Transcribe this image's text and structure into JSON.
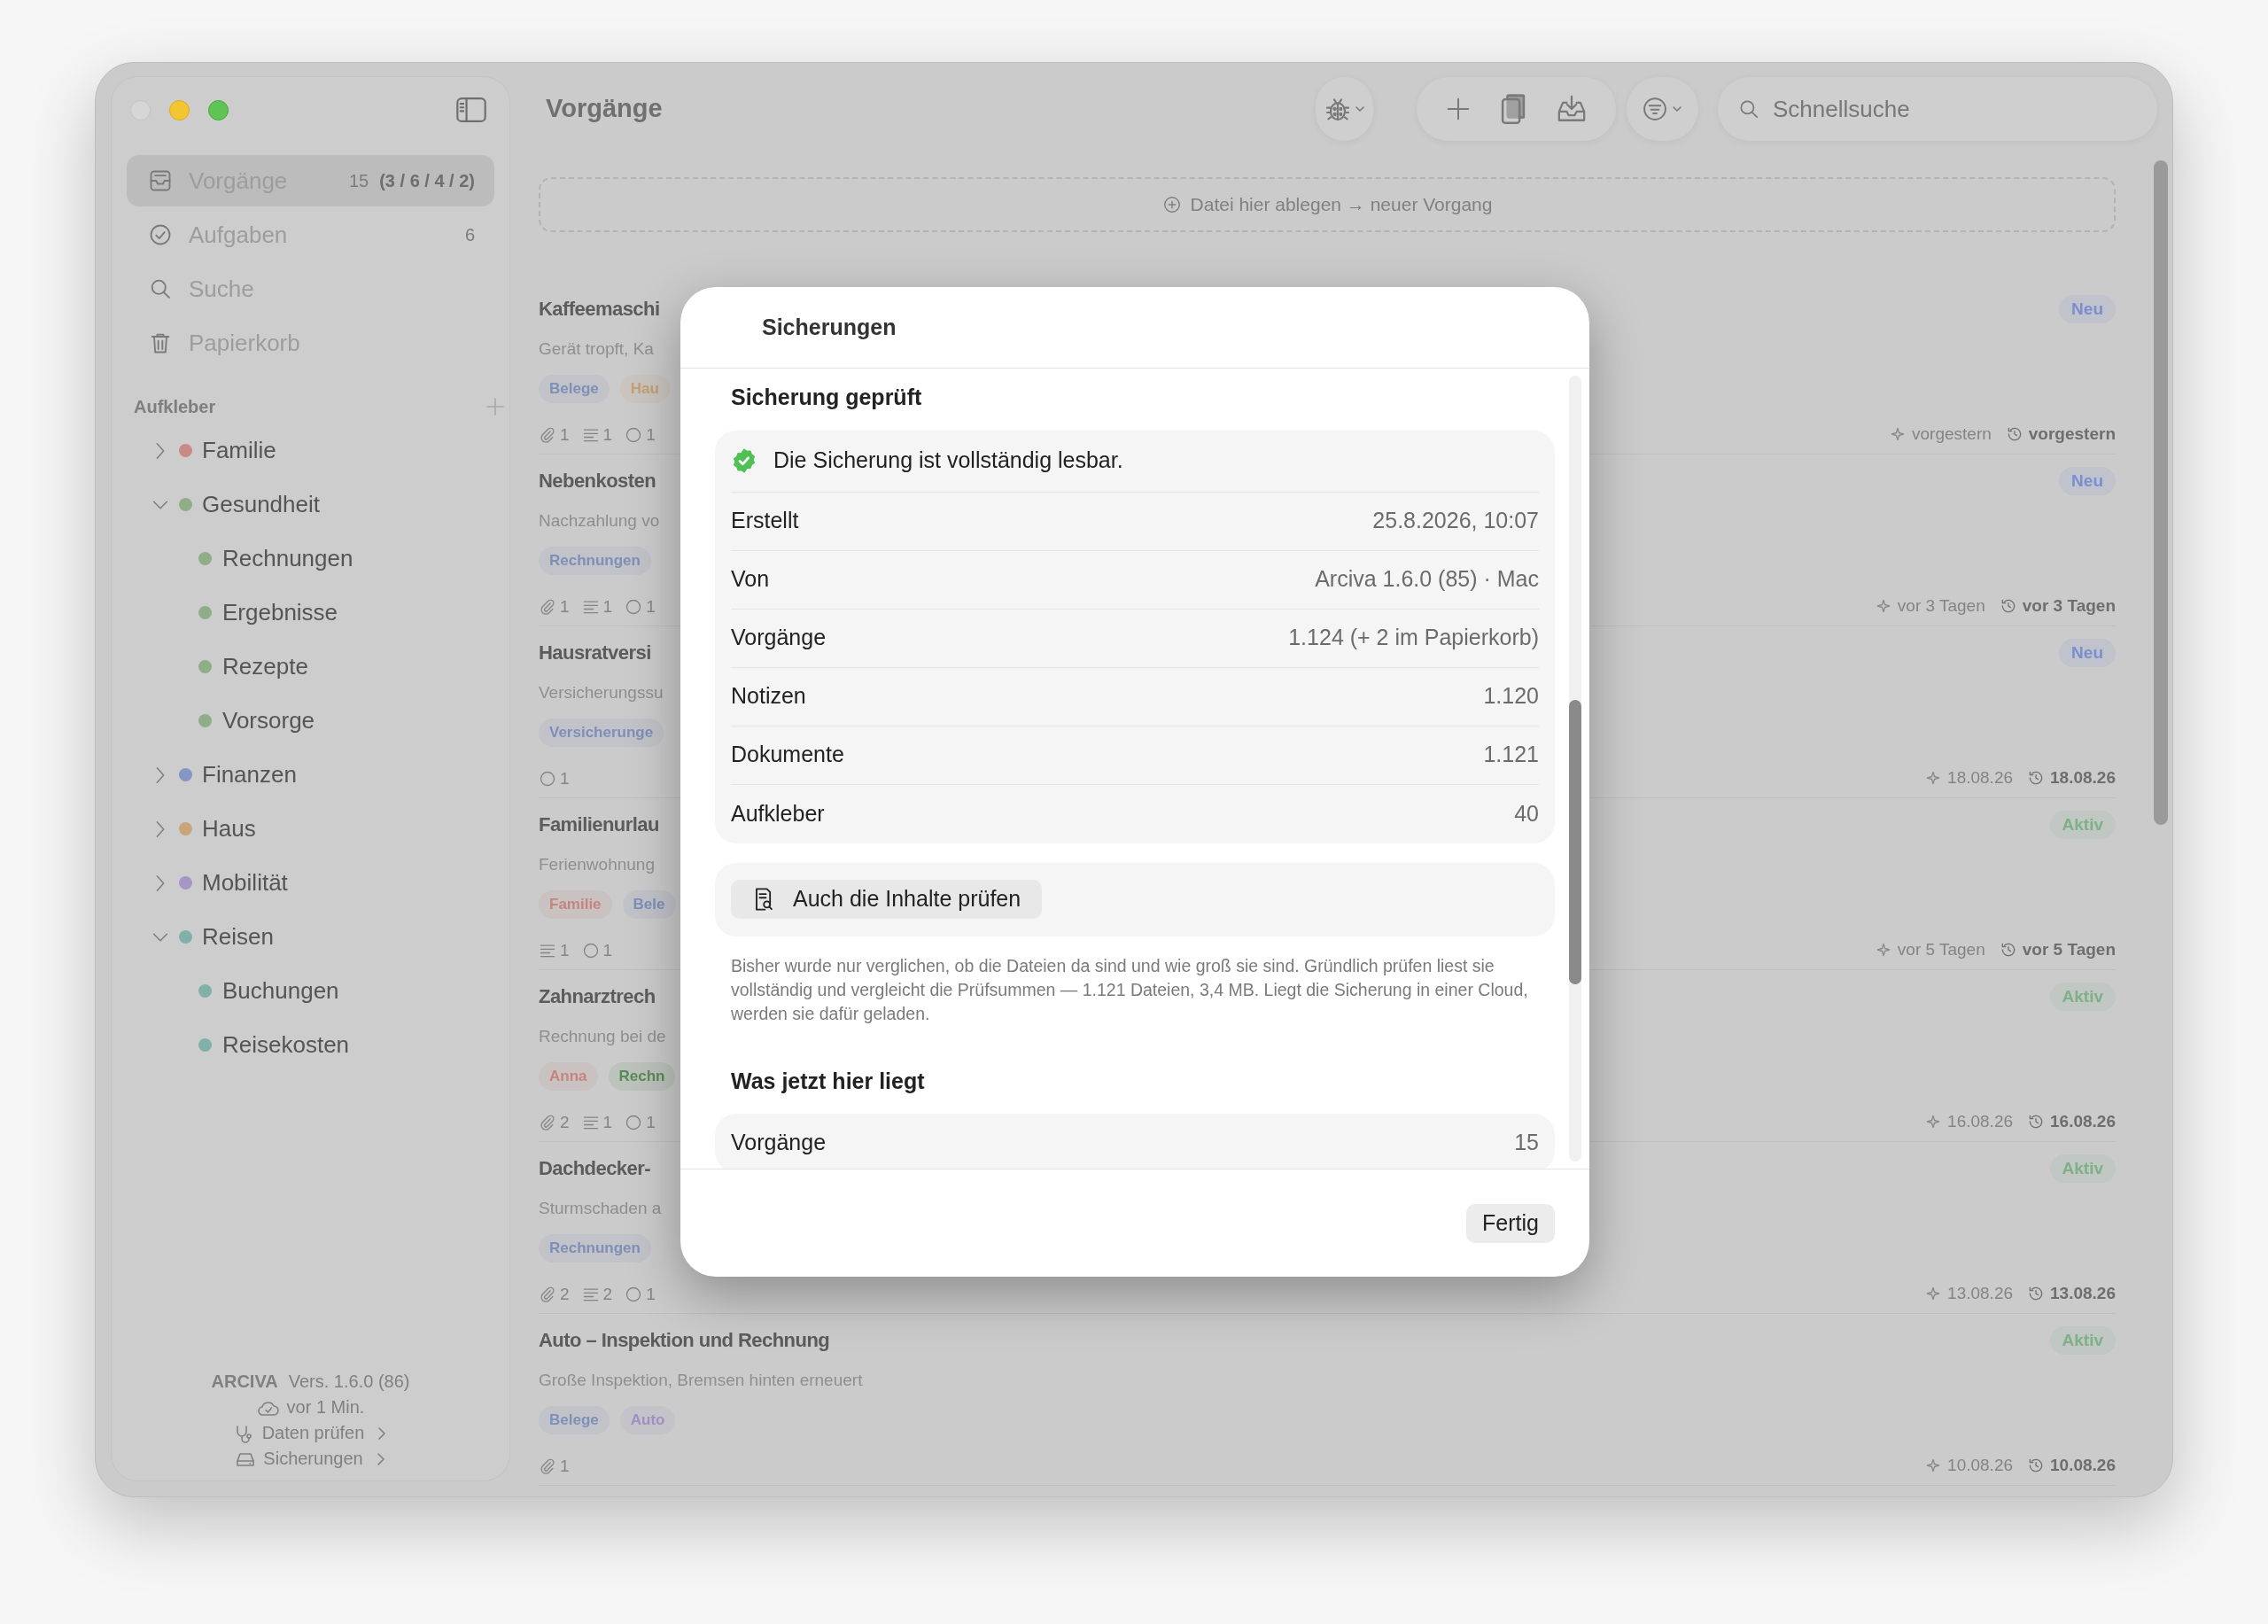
{
  "sidebar": {
    "nav": [
      {
        "kind": "inbox",
        "label": "Vorgänge",
        "count": "15",
        "detail": "(3 / 6 / 4 / 2)",
        "selected": true
      },
      {
        "kind": "tasks",
        "label": "Aufgaben",
        "count": "6",
        "selected": false
      },
      {
        "kind": "search",
        "label": "Suche",
        "selected": false
      },
      {
        "kind": "trash",
        "label": "Papierkorb",
        "selected": false
      }
    ],
    "stickers_heading": "Aufkleber",
    "stickers": [
      {
        "label": "Familie",
        "color": "#c98a85",
        "expanded": false
      },
      {
        "label": "Gesundheit",
        "color": "#8fae88",
        "expanded": true,
        "children": [
          {
            "label": "Rechnungen",
            "color": "#8fae88"
          },
          {
            "label": "Ergebnisse",
            "color": "#8fae88"
          },
          {
            "label": "Rezepte",
            "color": "#8fae88"
          },
          {
            "label": "Vorsorge",
            "color": "#8fae88"
          }
        ]
      },
      {
        "label": "Finanzen",
        "color": "#8496c4",
        "expanded": false
      },
      {
        "label": "Haus",
        "color": "#c9a57a",
        "expanded": false
      },
      {
        "label": "Mobilität",
        "color": "#a596c4",
        "expanded": false
      },
      {
        "label": "Reisen",
        "color": "#80b0a8",
        "expanded": true,
        "children": [
          {
            "label": "Buchungen",
            "color": "#80b0a8"
          },
          {
            "label": "Reisekosten",
            "color": "#80b0a8"
          }
        ]
      }
    ],
    "footer": {
      "app": "ARCIVA",
      "version": "Vers. 1.6.0 (86)",
      "synced": "vor 1 Min.",
      "links": [
        {
          "kind": "check",
          "label": "Daten prüfen"
        },
        {
          "kind": "backups",
          "label": "Sicherungen"
        }
      ]
    }
  },
  "toolbar": {
    "title": "Vorgänge",
    "search_placeholder": "Schnellsuche"
  },
  "drop_zone": "Datei hier ablegen → neuer Vorgang",
  "cases": [
    {
      "title": "Kaffeemaschi",
      "subtitle": "Gerät tropft, Ka",
      "tags": [
        {
          "label": "Belege",
          "color": "#7f8fb8"
        },
        {
          "label": "Hau",
          "color": "#c3a174"
        }
      ],
      "meta": [
        {
          "kind": "attachments",
          "count": "1"
        },
        {
          "kind": "notes",
          "count": "1"
        },
        {
          "kind": "tasks",
          "count": "1"
        }
      ],
      "badge": {
        "label": "Neu",
        "color": "#7a8ed0"
      },
      "created": "vorgestern",
      "modified": "vorgestern"
    },
    {
      "title": "Nebenkosten",
      "subtitle": "Nachzahlung vo",
      "tags": [
        {
          "label": "Rechnungen",
          "color": "#7f8fb8"
        }
      ],
      "meta": [
        {
          "kind": "attachments",
          "count": "1"
        },
        {
          "kind": "notes",
          "count": "1"
        },
        {
          "kind": "tasks",
          "count": "1"
        }
      ],
      "badge": {
        "label": "Neu",
        "color": "#7a8ed0"
      },
      "created": "vor 3 Tagen",
      "modified": "vor 3 Tagen"
    },
    {
      "title": "Hausratversi",
      "subtitle": "Versicherungssu",
      "tags": [
        {
          "label": "Versicherunge",
          "color": "#7f8fb8"
        }
      ],
      "meta": [
        {
          "kind": "tasks",
          "count": "1"
        }
      ],
      "badge": {
        "label": "Neu",
        "color": "#7a8ed0"
      },
      "created": "18.08.26",
      "modified": "18.08.26"
    },
    {
      "title": "Familienurlau",
      "subtitle": "Ferienwohnung",
      "tags": [
        {
          "label": "Familie",
          "color": "#c48580"
        },
        {
          "label": "Bele",
          "color": "#7f8fb8"
        }
      ],
      "meta": [
        {
          "kind": "notes",
          "count": "1"
        },
        {
          "kind": "tasks",
          "count": "1"
        }
      ],
      "badge": {
        "label": "Aktiv",
        "color": "#7fb08a"
      },
      "created": "vor 5 Tagen",
      "modified": "vor 5 Tagen"
    },
    {
      "title": "Zahnarztrech",
      "subtitle": "Rechnung bei de",
      "tags": [
        {
          "label": "Anna",
          "color": "#c48580"
        },
        {
          "label": "Rechn",
          "color": "#5a8a57"
        }
      ],
      "meta": [
        {
          "kind": "attachments",
          "count": "2"
        },
        {
          "kind": "notes",
          "count": "1"
        },
        {
          "kind": "tasks",
          "count": "1"
        }
      ],
      "badge": {
        "label": "Aktiv",
        "color": "#7fb08a"
      },
      "created": "16.08.26",
      "modified": "16.08.26"
    },
    {
      "title": "Dachdecker-",
      "subtitle": "Sturmschaden a",
      "tags": [
        {
          "label": "Rechnungen",
          "color": "#7f8fb8"
        }
      ],
      "meta": [
        {
          "kind": "attachments",
          "count": "2"
        },
        {
          "kind": "notes",
          "count": "2"
        },
        {
          "kind": "tasks",
          "count": "1"
        }
      ],
      "badge": {
        "label": "Aktiv",
        "color": "#7fb08a"
      },
      "created": "13.08.26",
      "modified": "13.08.26"
    },
    {
      "title": "Auto – Inspektion und Rechnung",
      "subtitle": "Große Inspektion, Bremsen hinten erneuert",
      "tags": [
        {
          "label": "Belege",
          "color": "#7f8fb8"
        },
        {
          "label": "Auto",
          "color": "#a08fc0"
        }
      ],
      "meta": [
        {
          "kind": "attachments",
          "count": "1"
        }
      ],
      "badge": {
        "label": "Aktiv",
        "color": "#7fb08a"
      },
      "created": "10.08.26",
      "modified": "10.08.26"
    }
  ],
  "dialog": {
    "title": "Sicherungen",
    "section": "Sicherung geprüft",
    "status": "Die Sicherung ist vollständig lesbar.",
    "rows": [
      {
        "label": "Erstellt",
        "value": "25.8.2026, 10:07"
      },
      {
        "label": "Von",
        "value": "Arciva 1.6.0 (85) · Mac"
      },
      {
        "label": "Vorgänge",
        "value": "1.124 (+ 2 im Papierkorb)"
      },
      {
        "label": "Notizen",
        "value": "1.120"
      },
      {
        "label": "Dokumente",
        "value": "1.121"
      },
      {
        "label": "Aufkleber",
        "value": "40"
      }
    ],
    "check_button": "Auch die Inhalte prüfen",
    "note": "Bisher wurde nur verglichen, ob die Dateien da sind und wie groß sie sind. Gründlich prüfen liest sie vollständig und vergleicht die Prüfsummen — 1.121 Dateien, 3,4 MB. Liegt die Sicherung in einer Cloud, werden sie dafür geladen.",
    "section2": "Was jetzt hier liegt",
    "rows2": [
      {
        "label": "Vorgänge",
        "value": "15"
      }
    ],
    "done_button": "Fertig"
  }
}
